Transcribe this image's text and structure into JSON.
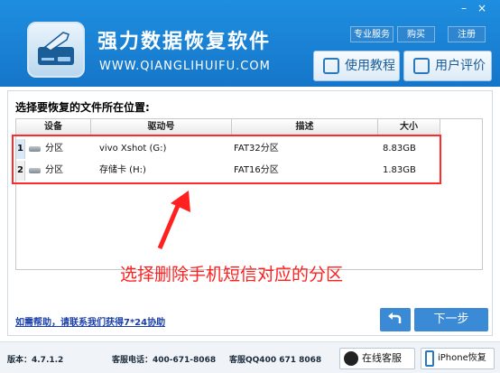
{
  "window": {
    "minimize": "–",
    "close": "×"
  },
  "header": {
    "title": "强力数据恢复软件",
    "url": "WWW.QIANGLIHUIFU.COM",
    "top_links": [
      "专业服务",
      "购买",
      "注册"
    ],
    "tutorial_button": "使用教程",
    "review_button": "用户评价"
  },
  "main": {
    "section_title": "选择要恢复的文件所在位置:",
    "table": {
      "columns": [
        "设备",
        "驱动号",
        "描述",
        "大小"
      ],
      "rows": [
        {
          "num": "1",
          "device": "分区",
          "drive": "vivo Xshot (G:)",
          "desc": "FAT32分区",
          "size": "8.83GB"
        },
        {
          "num": "2",
          "device": "分区",
          "drive": "存储卡 (H:)",
          "desc": "FAT16分区",
          "size": "1.83GB"
        }
      ]
    },
    "annotation": "选择删除手机短信对应的分区",
    "help_link": "如需帮助，请联系我们获得7*24协助",
    "next_button": "下一步"
  },
  "status": {
    "version": "版本：4.7.1.2",
    "phone": "客服电话：400-671-8068",
    "qq": "客服QQ400 671 8068",
    "online_service": "在线客服",
    "iphone_recovery": "iPhone恢复"
  },
  "colors": {
    "header": "#1a86d9",
    "accent": "#3a8ad6",
    "annotation": "#ff2020"
  }
}
